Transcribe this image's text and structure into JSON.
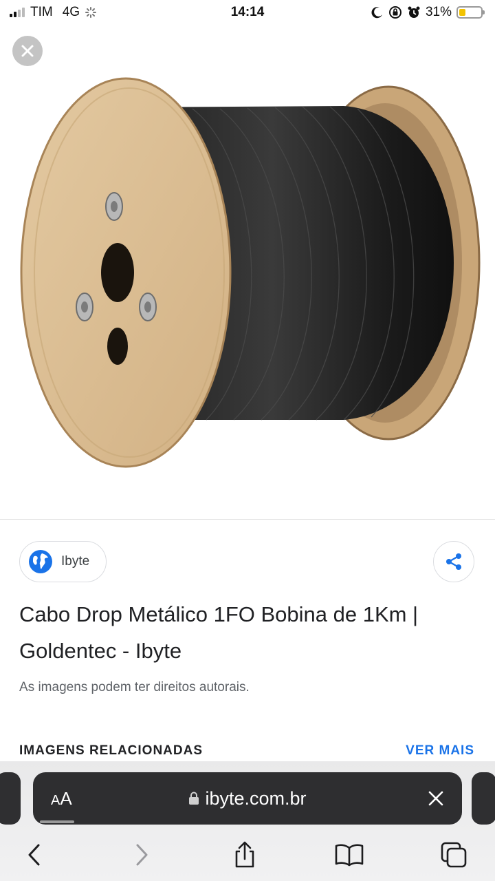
{
  "status_bar": {
    "carrier": "TIM",
    "network": "4G",
    "time": "14:14",
    "battery_percent": "31%",
    "battery_level": 0.31
  },
  "icons": {
    "close": "close-icon",
    "globe": "globe-icon",
    "share": "share-icon",
    "lock": "lock-icon",
    "back": "chevron-left-icon",
    "forward": "chevron-right-icon",
    "share_sheet": "share-sheet-icon",
    "bookmarks": "book-icon",
    "tabs": "tabs-icon"
  },
  "source": {
    "name": "Ibyte"
  },
  "result": {
    "title": "Cabo Drop Metálico 1FO Bobina de 1Km | Goldentec - Ibyte",
    "copyright_notice": "As imagens podem ter direitos autorais."
  },
  "related": {
    "heading": "IMAGENS RELACIONADAS",
    "see_more": "VER MAIS"
  },
  "browser": {
    "text_size_label_big": "A",
    "text_size_label_small": "A",
    "url": "ibyte.com.br"
  },
  "colors": {
    "link_blue": "#1a73e8",
    "globe_blue": "#1a73e8",
    "url_bar_bg": "#2e2e30"
  }
}
